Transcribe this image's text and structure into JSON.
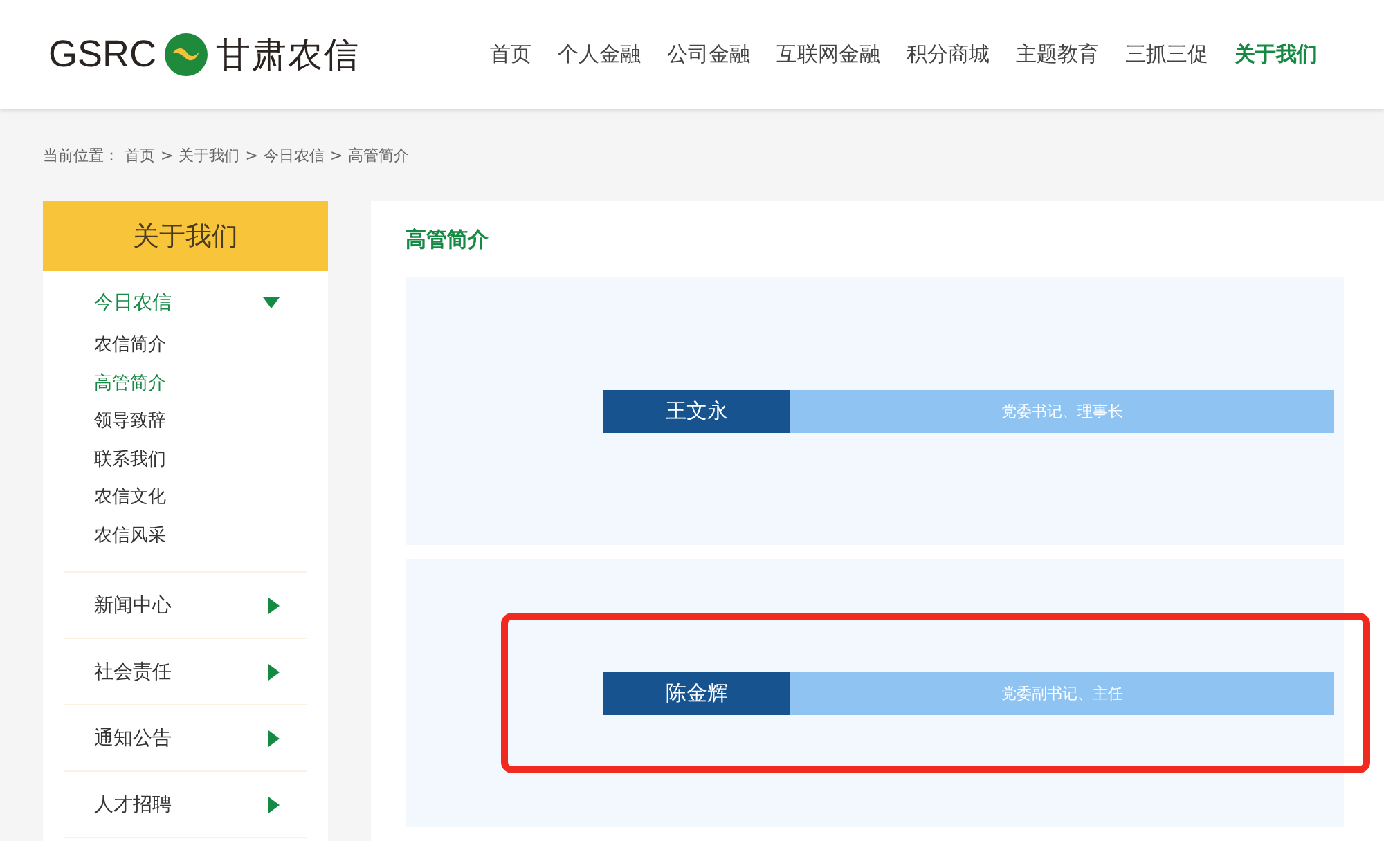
{
  "header": {
    "logo_text": "GSRC",
    "brand": "甘肃农信",
    "nav": [
      {
        "label": "首页",
        "selected": false
      },
      {
        "label": "个人金融",
        "selected": false
      },
      {
        "label": "公司金融",
        "selected": false
      },
      {
        "label": "互联网金融",
        "selected": false
      },
      {
        "label": "积分商城",
        "selected": false
      },
      {
        "label": "主题教育",
        "selected": false
      },
      {
        "label": "三抓三促",
        "selected": false
      },
      {
        "label": "关于我们",
        "selected": true
      }
    ]
  },
  "breadcrumb": {
    "label": "当前位置：",
    "separator": ">",
    "items": [
      "首页",
      "关于我们",
      "今日农信",
      "高管简介"
    ]
  },
  "sidebar": {
    "title": "关于我们",
    "items": [
      {
        "label": "今日农信",
        "expanded": true,
        "children": [
          {
            "label": "农信简介",
            "selected": false
          },
          {
            "label": "高管简介",
            "selected": true
          },
          {
            "label": "领导致辞",
            "selected": false
          },
          {
            "label": "联系我们",
            "selected": false
          },
          {
            "label": "农信文化",
            "selected": false
          },
          {
            "label": "农信风采",
            "selected": false
          }
        ]
      },
      {
        "label": "新闻中心",
        "expanded": false
      },
      {
        "label": "社会责任",
        "expanded": false
      },
      {
        "label": "通知公告",
        "expanded": false
      },
      {
        "label": "人才招聘",
        "expanded": false
      }
    ]
  },
  "content": {
    "title": "高管简介",
    "executives": [
      {
        "name": "王文永",
        "position": "党委书记、理事长",
        "highlighted": false
      },
      {
        "name": "陈金辉",
        "position": "党委副书记、主任",
        "highlighted": true
      }
    ]
  }
}
